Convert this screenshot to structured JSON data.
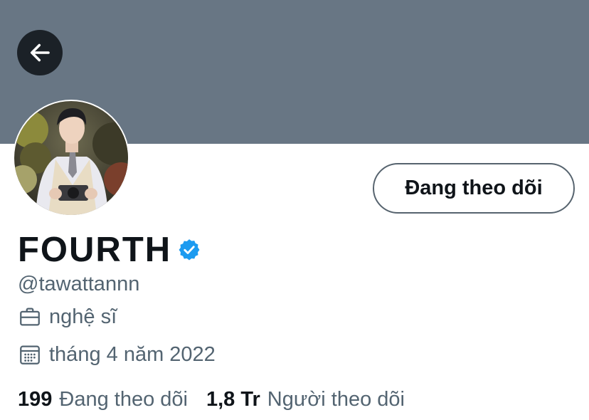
{
  "header": {
    "back_icon": "arrow-left-icon",
    "banner_color": "#687684"
  },
  "profile": {
    "name": "FOURTH",
    "verified_icon": "verified-badge-icon",
    "verified_color": "#1d9bf0",
    "handle": "@tawattannn",
    "profession_icon": "briefcase-icon",
    "profession": "nghệ sĩ",
    "joined_icon": "calendar-icon",
    "joined": "tháng 4 năm 2022",
    "follow_button_label": "Đang theo dõi"
  },
  "stats": {
    "following_count": "199",
    "following_label": "Đang theo dõi",
    "followers_count": "1,8 Tr",
    "followers_label": "Người theo dõi"
  }
}
